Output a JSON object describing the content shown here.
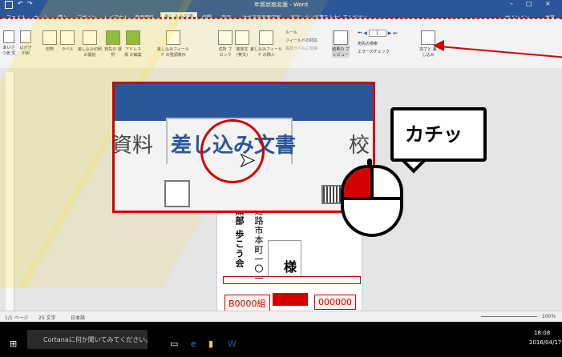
{
  "window": {
    "title": "年賀状宛名面 - Word",
    "signin": "サインイン",
    "share": "共有"
  },
  "tabs": [
    {
      "label": "ファイル"
    },
    {
      "label": "ホーム"
    },
    {
      "label": "挿入"
    },
    {
      "label": "デザイン"
    },
    {
      "label": "レイアウト"
    },
    {
      "label": "参考資料"
    },
    {
      "label": "差し込み文書"
    },
    {
      "label": "校閲"
    },
    {
      "label": "表示"
    },
    {
      "label": "はがき宛名面印刷"
    }
  ],
  "tell_me": "実行したい作業を入力してください...",
  "ribbon": {
    "groups": [
      {
        "label": "あいさつ状 文"
      },
      {
        "label": "はがき 印刷"
      },
      {
        "label": "封筒"
      },
      {
        "label": "ラベル"
      },
      {
        "label": "差し込み印刷 の開始"
      },
      {
        "label": "宛先の 選択"
      },
      {
        "label": "アドレス帳 の編集"
      },
      {
        "label": "差し込みフィールド の強調表示"
      },
      {
        "label": "住所 ブロック"
      },
      {
        "label": "挨拶文 (英文)"
      },
      {
        "label": "差し込みフィールド の挿入"
      },
      {
        "label": "結果の プレビュー"
      },
      {
        "label": "完了と 差し込み"
      }
    ],
    "rule_label": "ルール",
    "field_map": "フィールドの対応",
    "multi_label": "複数ラベルに反映",
    "record_index": "1",
    "find_recipient": "宛先の検索",
    "error_check": "エラーのチェック"
  },
  "zoom": {
    "tab_left": "資料",
    "tab_active": "差し込み文書",
    "tab_right": "校"
  },
  "callout": {
    "text": "カチッ"
  },
  "postcard": {
    "address": "姫路市本町一〇一",
    "name": "黒部 歩こう会",
    "honorific": "様",
    "code_left": "B0000組",
    "code_right": "000000"
  },
  "status_bar": {
    "page": "1/1 ページ",
    "words": "25 文字",
    "language": "日本語",
    "zoom": "100%"
  },
  "taskbar": {
    "cortana": "Cortanaに何か聞いてみてください。",
    "time": "18:08",
    "date": "2016/04/17"
  },
  "colors": {
    "word_blue": "#2b579a",
    "highlight_red": "#d40000"
  }
}
